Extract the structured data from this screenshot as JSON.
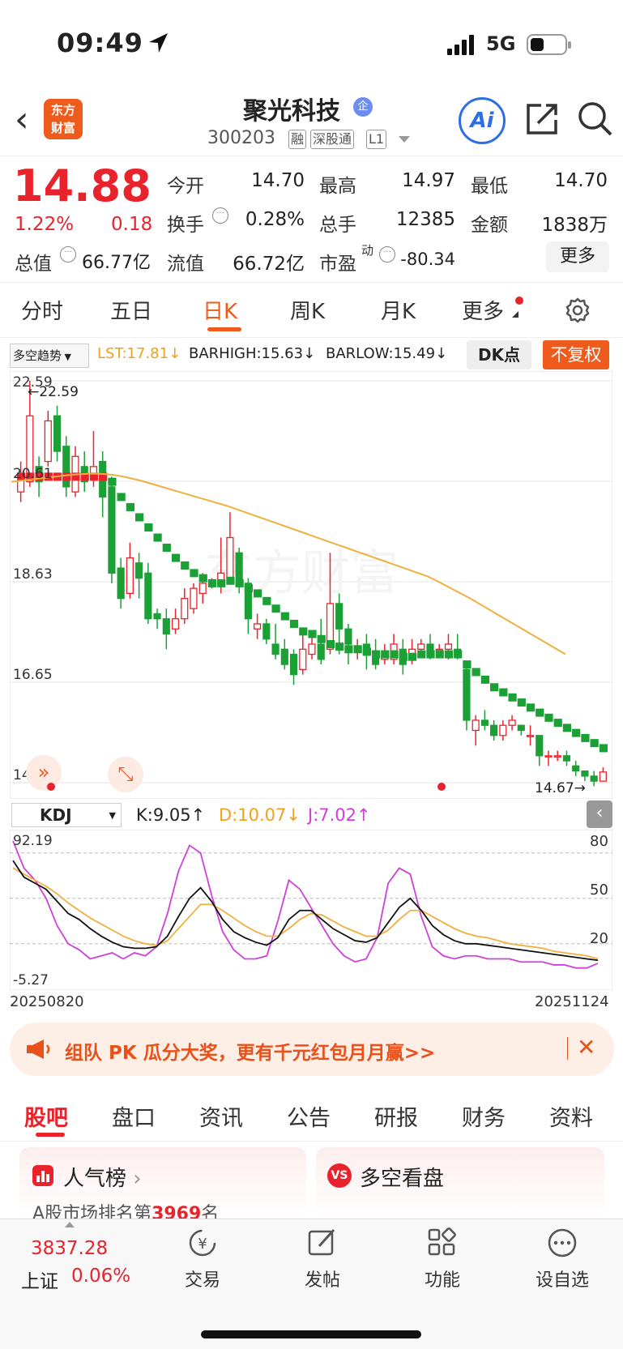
{
  "status_bar": {
    "time": "09:49",
    "network": "5G"
  },
  "header": {
    "logo_line1": "东方",
    "logo_line2": "财富",
    "stock_name": "聚光科技",
    "enterprise_badge": "企",
    "stock_code": "300203",
    "tags": [
      "融",
      "深股通",
      "L1"
    ],
    "ai_label": "Ai"
  },
  "quote": {
    "price": "14.88",
    "change_pct": "1.22%",
    "change": "0.18",
    "open_label": "今开",
    "open": "14.70",
    "high_label": "最高",
    "high": "14.97",
    "low_label": "最低",
    "low": "14.70",
    "turnover_label": "换手",
    "turnover": "0.28%",
    "volume_label": "总手",
    "volume": "12385",
    "amount_label": "金额",
    "amount": "1838万",
    "mktcap_label": "总值",
    "mktcap": "66.77亿",
    "float_label": "流值",
    "float": "66.72亿",
    "pe_label": "市盈",
    "pe_sup": "动",
    "pe": "-80.34",
    "more_button": "更多"
  },
  "period_tabs": [
    "分时",
    "五日",
    "日K",
    "周K",
    "月K",
    "更多"
  ],
  "active_tab": "日K",
  "indicators": {
    "select": "多空趋势",
    "lst": "LST:17.81",
    "barhigh": "BARHIGH:15.63",
    "barlow": "BARLOW:15.49",
    "dk_button": "DK点",
    "adjust_button": "不复权"
  },
  "kline": {
    "y_ticks": [
      "22.59",
      "20.61",
      "18.63",
      "16.65",
      "14.67"
    ],
    "max_label": "22.59",
    "min_label": "14.67",
    "watermark": "东方财富"
  },
  "kdj": {
    "select": "KDJ",
    "k": "K:9.05",
    "d": "D:10.07",
    "j": "J:7.02",
    "top": "92.19",
    "bottom": "-5.27",
    "levels": [
      "80",
      "50",
      "20"
    ],
    "start_date": "20250820",
    "end_date": "20251124"
  },
  "banner": {
    "text": "组队 PK 瓜分大奖，更有千元红包月月赢>>"
  },
  "bottom_tabs": [
    "股吧",
    "盘口",
    "资讯",
    "公告",
    "研报",
    "财务",
    "资料"
  ],
  "cards": {
    "popularity_title": "人气榜",
    "popularity_prefix": "A股市场排名第",
    "popularity_rank": "3969",
    "popularity_suffix": "名",
    "bullbear_title": "多空看盘"
  },
  "bottom_nav": {
    "index_value": "3837.28",
    "index_name": "上证",
    "index_change": "0.06%",
    "trade": "交易",
    "post": "发帖",
    "function": "功能",
    "watchlist": "设自选"
  },
  "colors": {
    "up": "#e8232c",
    "down": "#1aa034",
    "accent": "#ef5b1d",
    "ma": "#f0b040",
    "j_line": "#d040d8"
  },
  "chart_data": [
    {
      "type": "candlestick",
      "title": "",
      "ylim": [
        14.67,
        22.59
      ],
      "max": 22.59,
      "min": 14.67,
      "candles": [
        {
          "o": 20.4,
          "c": 20.7,
          "h": 21.0,
          "l": 20.2
        },
        {
          "o": 20.6,
          "c": 21.9,
          "h": 22.59,
          "l": 20.5
        },
        {
          "o": 20.9,
          "c": 20.6,
          "h": 21.1,
          "l": 20.3
        },
        {
          "o": 21.0,
          "c": 21.8,
          "h": 22.0,
          "l": 20.9
        },
        {
          "o": 21.9,
          "c": 21.2,
          "h": 22.1,
          "l": 21.0
        },
        {
          "o": 21.3,
          "c": 20.5,
          "h": 21.5,
          "l": 20.3
        },
        {
          "o": 20.4,
          "c": 21.1,
          "h": 21.3,
          "l": 20.3
        },
        {
          "o": 20.9,
          "c": 20.6,
          "h": 21.2,
          "l": 20.4
        },
        {
          "o": 20.7,
          "c": 20.9,
          "h": 21.6,
          "l": 20.5
        },
        {
          "o": 21.0,
          "c": 20.3,
          "h": 21.2,
          "l": 19.9
        },
        {
          "o": 20.5,
          "c": 18.8,
          "h": 20.7,
          "l": 18.6
        },
        {
          "o": 18.9,
          "c": 18.3,
          "h": 19.1,
          "l": 18.1
        },
        {
          "o": 18.4,
          "c": 19.1,
          "h": 19.4,
          "l": 18.3
        },
        {
          "o": 19.0,
          "c": 18.7,
          "h": 19.2,
          "l": 18.3
        },
        {
          "o": 18.8,
          "c": 17.9,
          "h": 19.0,
          "l": 17.8
        },
        {
          "o": 18.0,
          "c": 17.9,
          "h": 18.1,
          "l": 17.7
        },
        {
          "o": 17.9,
          "c": 17.6,
          "h": 18.1,
          "l": 17.3
        },
        {
          "o": 17.7,
          "c": 17.9,
          "h": 18.1,
          "l": 17.6
        },
        {
          "o": 17.9,
          "c": 18.3,
          "h": 18.5,
          "l": 17.8
        },
        {
          "o": 18.1,
          "c": 18.5,
          "h": 18.6,
          "l": 18.0
        },
        {
          "o": 18.4,
          "c": 18.6,
          "h": 18.8,
          "l": 18.2
        },
        {
          "o": 18.6,
          "c": 18.6,
          "h": 18.7,
          "l": 18.5
        },
        {
          "o": 18.6,
          "c": 18.8,
          "h": 19.5,
          "l": 18.4
        },
        {
          "o": 18.7,
          "c": 19.5,
          "h": 20.0,
          "l": 18.6
        },
        {
          "o": 19.2,
          "c": 18.6,
          "h": 19.3,
          "l": 18.4
        },
        {
          "o": 18.6,
          "c": 17.9,
          "h": 18.7,
          "l": 17.6
        },
        {
          "o": 17.7,
          "c": 17.8,
          "h": 18.0,
          "l": 17.5
        },
        {
          "o": 17.8,
          "c": 17.5,
          "h": 17.9,
          "l": 17.4
        },
        {
          "o": 17.4,
          "c": 17.2,
          "h": 17.8,
          "l": 17.1
        },
        {
          "o": 17.3,
          "c": 17.0,
          "h": 17.5,
          "l": 16.9
        },
        {
          "o": 17.2,
          "c": 16.8,
          "h": 17.3,
          "l": 16.6
        },
        {
          "o": 16.9,
          "c": 17.3,
          "h": 17.6,
          "l": 16.8
        },
        {
          "o": 17.2,
          "c": 17.4,
          "h": 17.6,
          "l": 17.1
        },
        {
          "o": 17.4,
          "c": 17.1,
          "h": 17.9,
          "l": 17.0
        },
        {
          "o": 17.3,
          "c": 18.2,
          "h": 19.2,
          "l": 17.2
        },
        {
          "o": 18.2,
          "c": 17.7,
          "h": 18.4,
          "l": 17.2
        },
        {
          "o": 17.7,
          "c": 17.4,
          "h": 17.8,
          "l": 17.0
        },
        {
          "o": 17.3,
          "c": 17.3,
          "h": 17.5,
          "l": 17.1
        },
        {
          "o": 17.4,
          "c": 17.2,
          "h": 17.6,
          "l": 16.9
        },
        {
          "o": 17.2,
          "c": 17.0,
          "h": 17.5,
          "l": 16.9
        },
        {
          "o": 17.1,
          "c": 17.2,
          "h": 17.4,
          "l": 17.0
        },
        {
          "o": 17.1,
          "c": 17.4,
          "h": 17.6,
          "l": 17.0
        },
        {
          "o": 17.3,
          "c": 17.0,
          "h": 17.5,
          "l": 16.8
        },
        {
          "o": 17.2,
          "c": 17.3,
          "h": 17.5,
          "l": 17.0
        },
        {
          "o": 17.3,
          "c": 17.4,
          "h": 17.5,
          "l": 17.2
        },
        {
          "o": 17.4,
          "c": 17.2,
          "h": 17.6,
          "l": 17.1
        },
        {
          "o": 17.3,
          "c": 17.3,
          "h": 17.4,
          "l": 17.2
        },
        {
          "o": 17.3,
          "c": 17.4,
          "h": 17.6,
          "l": 17.1
        },
        {
          "o": 17.3,
          "c": 17.2,
          "h": 17.6,
          "l": 17.1
        },
        {
          "o": 16.9,
          "c": 15.9,
          "h": 17.0,
          "l": 15.7
        },
        {
          "o": 15.7,
          "c": 15.9,
          "h": 16.0,
          "l": 15.4
        },
        {
          "o": 15.9,
          "c": 15.8,
          "h": 16.1,
          "l": 15.7
        },
        {
          "o": 15.8,
          "c": 15.6,
          "h": 15.9,
          "l": 15.5
        },
        {
          "o": 15.6,
          "c": 15.8,
          "h": 15.9,
          "l": 15.5
        },
        {
          "o": 15.8,
          "c": 15.9,
          "h": 16.0,
          "l": 15.7
        },
        {
          "o": 15.8,
          "c": 15.7,
          "h": 15.8,
          "l": 15.6
        },
        {
          "o": 15.6,
          "c": 15.6,
          "h": 15.8,
          "l": 15.4
        },
        {
          "o": 15.6,
          "c": 15.2,
          "h": 15.6,
          "l": 15.0
        },
        {
          "o": 15.2,
          "c": 15.2,
          "h": 15.3,
          "l": 15.0
        },
        {
          "o": 15.2,
          "c": 15.2,
          "h": 15.3,
          "l": 15.1
        },
        {
          "o": 15.2,
          "c": 15.1,
          "h": 15.3,
          "l": 15.0
        },
        {
          "o": 15.0,
          "c": 14.9,
          "h": 15.1,
          "l": 14.8
        },
        {
          "o": 14.9,
          "c": 14.8,
          "h": 14.9,
          "l": 14.7
        },
        {
          "o": 14.8,
          "c": 14.7,
          "h": 14.9,
          "l": 14.6
        },
        {
          "o": 14.7,
          "c": 14.88,
          "h": 14.97,
          "l": 14.7
        }
      ],
      "ma_line": [
        20.6,
        20.62,
        20.64,
        20.66,
        20.68,
        20.7,
        20.72,
        20.74,
        20.75,
        20.76,
        20.76,
        20.75,
        20.73,
        20.7,
        20.66,
        20.62,
        20.57,
        20.52,
        20.47,
        20.42,
        20.37,
        20.32,
        20.27,
        20.22,
        20.17,
        20.12,
        20.06,
        20.0,
        19.94,
        19.88,
        19.82,
        19.76,
        19.7,
        19.64,
        19.58,
        19.52,
        19.46,
        19.4,
        19.34,
        19.28,
        19.22,
        19.16,
        19.1,
        19.04,
        18.98,
        18.92,
        18.86,
        18.8,
        18.74,
        18.66,
        18.57,
        18.48,
        18.39,
        18.3,
        18.2,
        18.1,
        18.0,
        17.9,
        17.8,
        17.7,
        17.6,
        17.5,
        17.4,
        17.3,
        17.2
      ],
      "trend_line": [
        20.7,
        20.7,
        20.7,
        20.7,
        20.7,
        20.7,
        20.7,
        20.7,
        20.7,
        20.7,
        20.6,
        20.3,
        20.1,
        19.9,
        19.7,
        19.5,
        19.3,
        19.1,
        18.95,
        18.8,
        18.7,
        18.6,
        18.6,
        18.65,
        18.6,
        18.5,
        18.4,
        18.25,
        18.1,
        17.95,
        17.8,
        17.65,
        17.6,
        17.5,
        17.4,
        17.35,
        17.3,
        17.3,
        17.25,
        17.2,
        17.2,
        17.2,
        17.15,
        17.15,
        17.2,
        17.2,
        17.2,
        17.2,
        17.2,
        17.0,
        16.85,
        16.7,
        16.55,
        16.45,
        16.35,
        16.25,
        16.15,
        16.05,
        15.95,
        15.85,
        15.75,
        15.65,
        15.55,
        15.45,
        15.35
      ]
    },
    {
      "type": "line",
      "title": "",
      "ylim": [
        -5.27,
        92.19
      ],
      "series": [
        {
          "name": "K",
          "values": [
            75,
            64,
            60,
            56,
            48,
            40,
            36,
            30,
            25,
            21,
            18,
            17,
            17,
            18,
            25,
            38,
            50,
            57,
            48,
            36,
            28,
            24,
            21,
            19,
            24,
            36,
            42,
            42,
            36,
            30,
            26,
            22,
            21,
            24,
            34,
            44,
            50,
            42,
            32,
            26,
            22,
            20,
            20,
            19,
            18,
            17,
            16,
            15,
            14,
            13,
            12,
            11,
            10,
            9.05
          ]
        },
        {
          "name": "D",
          "values": [
            70,
            66,
            62,
            58,
            53,
            47,
            42,
            37,
            33,
            29,
            25,
            22,
            20,
            19,
            22,
            30,
            38,
            46,
            46,
            42,
            37,
            32,
            28,
            25,
            25,
            30,
            36,
            40,
            39,
            35,
            31,
            28,
            25,
            25,
            29,
            36,
            42,
            42,
            38,
            34,
            30,
            27,
            25,
            24,
            22,
            20,
            19,
            18,
            17,
            15,
            14,
            13,
            12,
            10.07
          ]
        },
        {
          "name": "J",
          "values": [
            88,
            70,
            62,
            50,
            32,
            20,
            16,
            10,
            12,
            14,
            10,
            14,
            12,
            18,
            40,
            68,
            85,
            80,
            52,
            28,
            16,
            10,
            10,
            12,
            35,
            62,
            56,
            44,
            32,
            20,
            12,
            8,
            10,
            24,
            60,
            70,
            66,
            38,
            18,
            12,
            10,
            12,
            12,
            10,
            10,
            10,
            8,
            8,
            8,
            6,
            6,
            4,
            4,
            7.02
          ]
        }
      ]
    }
  ]
}
